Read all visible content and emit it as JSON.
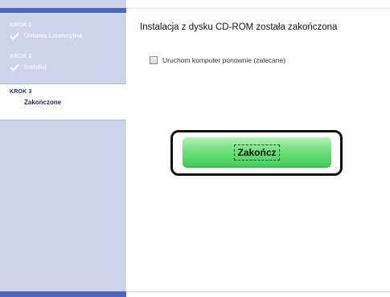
{
  "sidebar": {
    "steps": [
      {
        "label": "KROK 1",
        "name": "Umowa Licencyjna",
        "status": "done"
      },
      {
        "label": "KROK 2",
        "name": "Instaluj",
        "status": "done"
      },
      {
        "label": "KROK 3",
        "name": "Zakończone",
        "status": "current"
      }
    ],
    "colors": {
      "background": "#cdd3ea",
      "bar": "#4e66b8"
    }
  },
  "main": {
    "title": "Instalacja z dysku CD-ROM została zakończona",
    "restart_checkbox": {
      "label": "Uruchom komputer ponownie (zalecane)",
      "checked": false
    },
    "finish_button": {
      "label": "Zakończ",
      "color": "#5fd86d"
    }
  }
}
